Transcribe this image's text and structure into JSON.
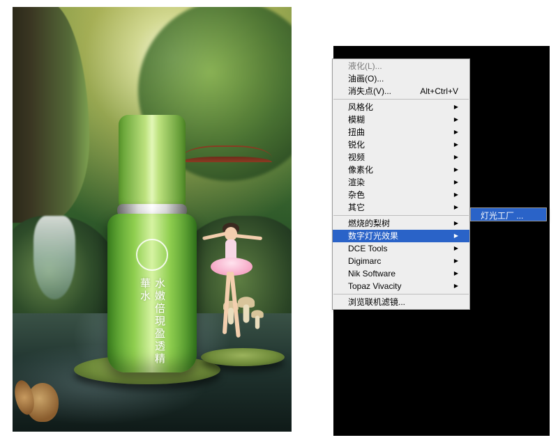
{
  "artwork": {
    "product_label": "水嫩倍現盈透精華水"
  },
  "menu": {
    "top": [
      {
        "label": "液化(L)...",
        "shortcut": ""
      },
      {
        "label": "油画(O)...",
        "shortcut": ""
      },
      {
        "label": "消失点(V)...",
        "shortcut": "Alt+Ctrl+V"
      }
    ],
    "builtins": [
      "风格化",
      "模糊",
      "扭曲",
      "锐化",
      "视频",
      "像素化",
      "渲染",
      "杂色",
      "其它"
    ],
    "plugins": [
      "燃烧的梨树",
      "数字灯光效果",
      "DCE Tools",
      "Digimarc",
      "Nik Software",
      "Topaz Vivacity"
    ],
    "bottom": "浏览联机滤镜...",
    "selected_plugin": "数字灯光效果",
    "submenu_item": "灯光工厂",
    "submenu_ellipsis": "..."
  }
}
